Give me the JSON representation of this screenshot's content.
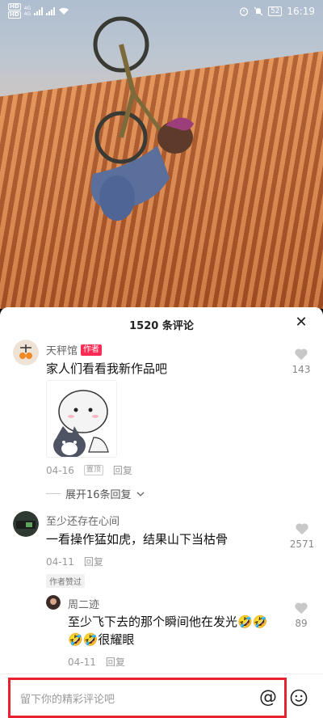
{
  "status_bar": {
    "time": "16:19",
    "battery": "52",
    "network_left": [
      "HD",
      "HD"
    ],
    "signal_labels": [
      "4G",
      "4G"
    ]
  },
  "comments_panel": {
    "title": "1520 条评论",
    "close_icon": "close-icon"
  },
  "comments": [
    {
      "user": "天秤馆",
      "tag": "作者",
      "text": "家人们看看我新作品吧",
      "date": "04-16",
      "pinned_label": "置顶",
      "reply_label": "回复",
      "likes": "143",
      "expand_label": "展开16条回复"
    },
    {
      "user": "至少还存在心间",
      "text": "一看操作猛如虎，结果山下当枯骨",
      "date": "04-11",
      "reply_label": "回复",
      "likes": "2571",
      "liked_by_author": "作者赞过"
    },
    {
      "user": "周二迹",
      "text_line1": "至少飞下去的那个瞬间他在发光🤣🤣",
      "text_line2": "🤣🤣很耀眼",
      "date": "04-11",
      "reply_label": "回复",
      "likes": "89"
    }
  ],
  "input": {
    "placeholder": "留下你的精彩评论吧",
    "at_symbol": "@",
    "emoji_icon": "smiley-icon"
  },
  "colors": {
    "accent": "#fe2c55",
    "highlight_border": "#e8212f"
  }
}
